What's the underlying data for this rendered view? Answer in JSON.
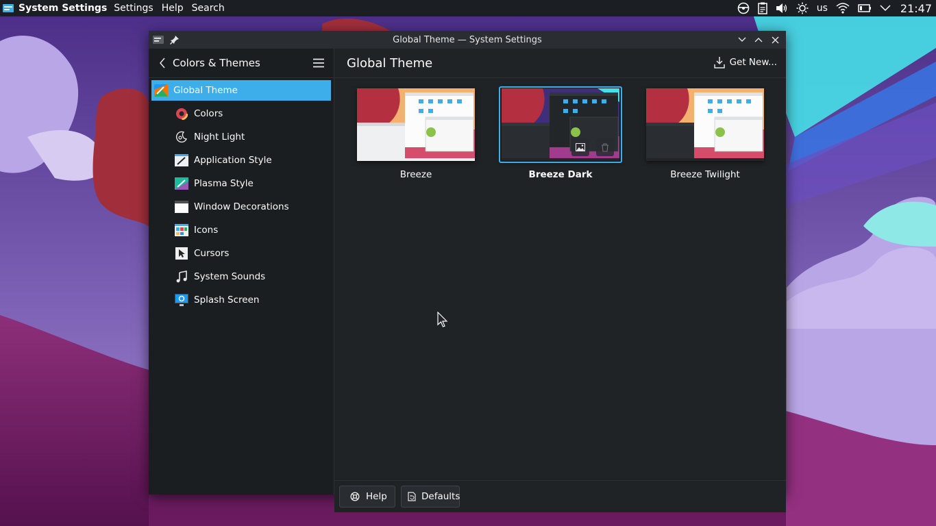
{
  "panel": {
    "app_name": "System Settings",
    "menus": [
      "Settings",
      "Help",
      "Search"
    ],
    "keyboard_layout": "us",
    "clock": "21:47"
  },
  "window": {
    "title": "Global Theme — System Settings"
  },
  "sidebar": {
    "title": "Colors & Themes",
    "items": [
      {
        "label": "Global Theme",
        "icon": "global-theme-icon",
        "selected": true
      },
      {
        "label": "Colors",
        "icon": "colors-icon"
      },
      {
        "label": "Night Light",
        "icon": "night-light-icon"
      },
      {
        "label": "Application Style",
        "icon": "application-style-icon"
      },
      {
        "label": "Plasma Style",
        "icon": "plasma-style-icon"
      },
      {
        "label": "Window Decorations",
        "icon": "window-decorations-icon"
      },
      {
        "label": "Icons",
        "icon": "icons-icon"
      },
      {
        "label": "Cursors",
        "icon": "cursors-icon"
      },
      {
        "label": "System Sounds",
        "icon": "system-sounds-icon"
      },
      {
        "label": "Splash Screen",
        "icon": "splash-screen-icon"
      }
    ]
  },
  "main": {
    "title": "Global Theme",
    "get_new": "Get New...",
    "themes": [
      {
        "name": "Breeze",
        "variant": "light",
        "selected": false
      },
      {
        "name": "Breeze Dark",
        "variant": "dark",
        "selected": true
      },
      {
        "name": "Breeze Twilight",
        "variant": "twilight",
        "selected": false
      }
    ]
  },
  "footer": {
    "help": "Help",
    "defaults": "Defaults"
  },
  "colors": {
    "accent": "#3daee9",
    "window_bg": "#202326",
    "sidebar_bg": "#1b1e20",
    "panel_bg": "#1b1e22"
  }
}
